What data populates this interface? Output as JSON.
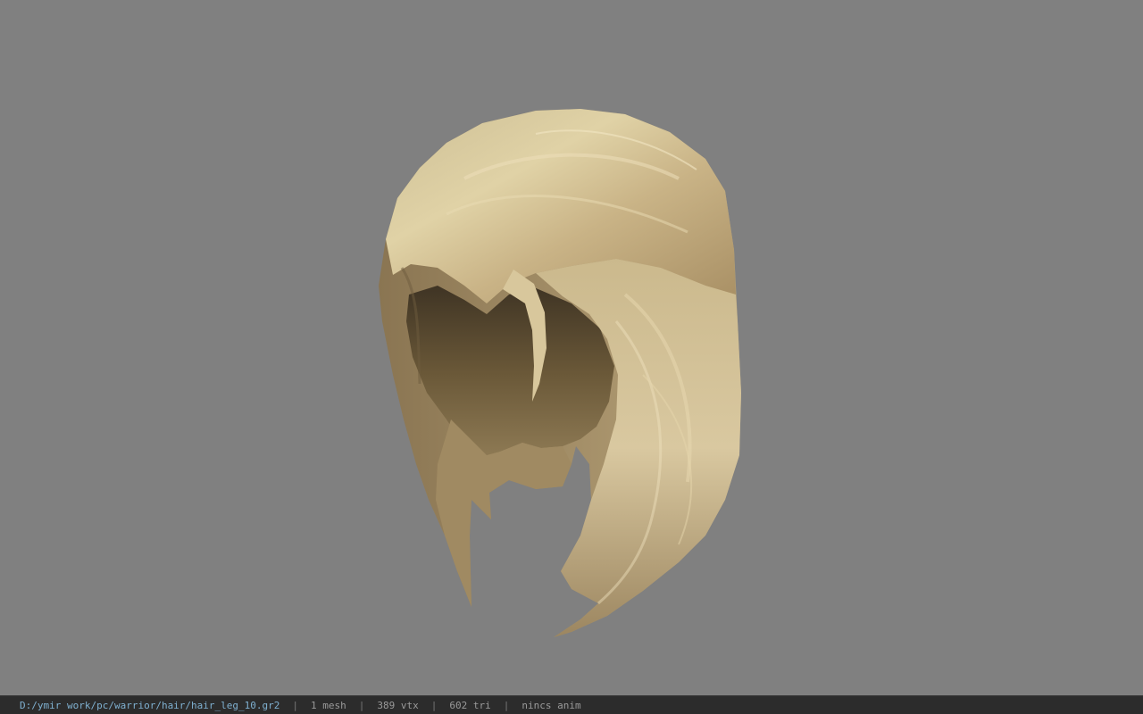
{
  "viewport": {
    "background_color": "#808080",
    "model_name": "hair mesh",
    "hair_color": "#c8b58a"
  },
  "status_bar": {
    "file_path": "D:/ymir work/pc/warrior/hair/hair_leg_10.gr2",
    "separator": "|",
    "mesh_count": "1 mesh",
    "vertex_count": "389 vtx",
    "triangle_count": "602 tri",
    "anim_status": "nincs anim"
  }
}
